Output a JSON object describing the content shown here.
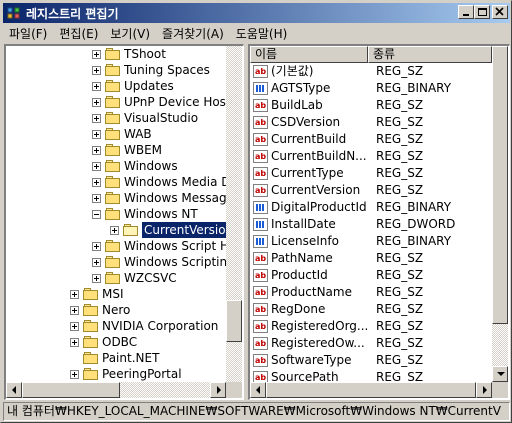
{
  "window": {
    "title": "레지스트리 편집기"
  },
  "menu": [
    "파일(F)",
    "편집(E)",
    "보기(V)",
    "즐겨찾기(A)",
    "도움말(H)"
  ],
  "tree": {
    "items": [
      {
        "label": "TShoot",
        "expander": "plus",
        "folder": "closed",
        "depth": 3
      },
      {
        "label": "Tuning Spaces",
        "expander": "plus",
        "folder": "closed",
        "depth": 3
      },
      {
        "label": "Updates",
        "expander": "plus",
        "folder": "closed",
        "depth": 3
      },
      {
        "label": "UPnP Device Hos",
        "expander": "plus",
        "folder": "closed",
        "depth": 3
      },
      {
        "label": "VisualStudio",
        "expander": "plus",
        "folder": "closed",
        "depth": 3
      },
      {
        "label": "WAB",
        "expander": "plus",
        "folder": "closed",
        "depth": 3
      },
      {
        "label": "WBEM",
        "expander": "plus",
        "folder": "closed",
        "depth": 3
      },
      {
        "label": "Windows",
        "expander": "plus",
        "folder": "closed",
        "depth": 3
      },
      {
        "label": "Windows Media D",
        "expander": "plus",
        "folder": "closed",
        "depth": 3
      },
      {
        "label": "Windows Messag",
        "expander": "plus",
        "folder": "closed",
        "depth": 3
      },
      {
        "label": "Windows NT",
        "expander": "minus",
        "folder": "closed",
        "depth": 3
      },
      {
        "label": "CurrentVersion",
        "expander": "plus",
        "folder": "open",
        "depth": 4,
        "selected": true
      },
      {
        "label": "Windows Script H",
        "expander": "plus",
        "folder": "closed",
        "depth": 3
      },
      {
        "label": "Windows Scriptin",
        "expander": "plus",
        "folder": "closed",
        "depth": 3
      },
      {
        "label": "WZCSVC",
        "expander": "plus",
        "folder": "closed",
        "depth": 3
      },
      {
        "label": "MSI",
        "expander": "plus",
        "folder": "closed",
        "depth": 2
      },
      {
        "label": "Nero",
        "expander": "plus",
        "folder": "closed",
        "depth": 2
      },
      {
        "label": "NVIDIA Corporation",
        "expander": "plus",
        "folder": "closed",
        "depth": 2
      },
      {
        "label": "ODBC",
        "expander": "plus",
        "folder": "closed",
        "depth": 2
      },
      {
        "label": "Paint.NET",
        "expander": "none",
        "folder": "closed",
        "depth": 2
      },
      {
        "label": "PeeringPortal",
        "expander": "plus",
        "folder": "closed",
        "depth": 2
      }
    ]
  },
  "list": {
    "columns": [
      "이름",
      "종류"
    ],
    "rows": [
      {
        "name": "(기본값)",
        "type": "REG_SZ",
        "icon": "str"
      },
      {
        "name": "AGTSType",
        "type": "REG_BINARY",
        "icon": "bin"
      },
      {
        "name": "BuildLab",
        "type": "REG_SZ",
        "icon": "str"
      },
      {
        "name": "CSDVersion",
        "type": "REG_SZ",
        "icon": "str"
      },
      {
        "name": "CurrentBuild",
        "type": "REG_SZ",
        "icon": "str"
      },
      {
        "name": "CurrentBuildN...",
        "type": "REG_SZ",
        "icon": "str"
      },
      {
        "name": "CurrentType",
        "type": "REG_SZ",
        "icon": "str"
      },
      {
        "name": "CurrentVersion",
        "type": "REG_SZ",
        "icon": "str"
      },
      {
        "name": "DigitalProductId",
        "type": "REG_BINARY",
        "icon": "bin"
      },
      {
        "name": "InstallDate",
        "type": "REG_DWORD",
        "icon": "bin"
      },
      {
        "name": "LicenseInfo",
        "type": "REG_BINARY",
        "icon": "bin"
      },
      {
        "name": "PathName",
        "type": "REG_SZ",
        "icon": "str"
      },
      {
        "name": "ProductId",
        "type": "REG_SZ",
        "icon": "str"
      },
      {
        "name": "ProductName",
        "type": "REG_SZ",
        "icon": "str"
      },
      {
        "name": "RegDone",
        "type": "REG_SZ",
        "icon": "str"
      },
      {
        "name": "RegisteredOrg...",
        "type": "REG_SZ",
        "icon": "str"
      },
      {
        "name": "RegisteredOw...",
        "type": "REG_SZ",
        "icon": "str"
      },
      {
        "name": "SoftwareType",
        "type": "REG_SZ",
        "icon": "str"
      },
      {
        "name": "SourcePath",
        "type": "REG_SZ",
        "icon": "str"
      }
    ],
    "string_icon_text": "ab"
  },
  "status": {
    "path": "내 컴퓨터₩HKEY_LOCAL_MACHINE₩SOFTWARE₩Microsoft₩Windows NT₩CurrentV"
  }
}
